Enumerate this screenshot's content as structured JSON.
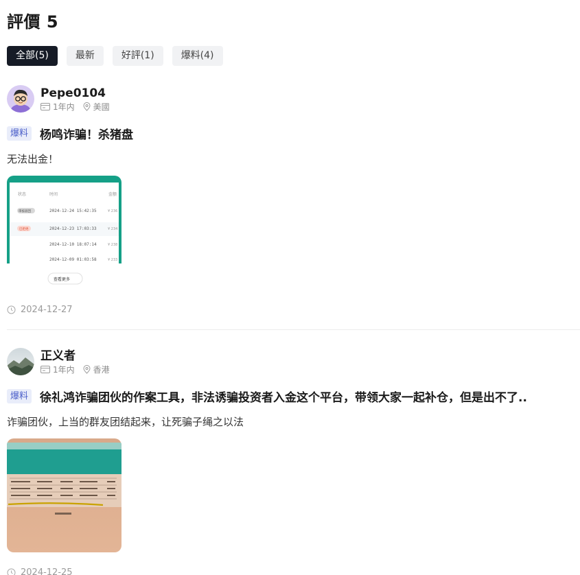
{
  "header": {
    "title": "評價 5"
  },
  "tabs": [
    {
      "label": "全部(5)",
      "active": true
    },
    {
      "label": "最新",
      "active": false
    },
    {
      "label": "好評(1)",
      "active": false
    },
    {
      "label": "爆料(4)",
      "active": false
    }
  ],
  "reviews": [
    {
      "author": "Pepe0104",
      "duration": "1年内",
      "location": "美國",
      "tag": "爆料",
      "title": "杨鸣诈骗！杀猪盘",
      "body": "无法出金！",
      "date": "2024-12-27",
      "thumbnail": {
        "header_cols": [
          "状态",
          "时间",
          "金额"
        ],
        "rows": [
          {
            "status": "审核驳回",
            "time": "2024-12-24 15:42:35",
            "amount": "¥ 236"
          },
          {
            "status": "已拒绝",
            "time": "2024-12-23 17:03:33",
            "amount": "¥ 234"
          },
          {
            "status": "",
            "time": "2024-12-10 18:07:14",
            "amount": "¥ 238"
          },
          {
            "status": "",
            "time": "2024-12-09 01:03:58",
            "amount": "¥ 233"
          }
        ],
        "more_label": "查看更多"
      }
    },
    {
      "author": "正义者",
      "duration": "1年内",
      "location": "香港",
      "tag": "爆料",
      "title": "徐礼鸿诈骗团伙的作案工具，非法诱骗投资者入金这个平台，带领大家一起补仓，但是出不了..",
      "body": "诈骗团伙，上当的群友团结起来，让死骗子绳之以法",
      "date": "2024-12-25"
    }
  ],
  "colors": {
    "active_tab_bg": "#161b26",
    "tag_bg": "#e9edfa",
    "tag_text": "#4b5fc9",
    "thumb_teal": "#15a087"
  }
}
